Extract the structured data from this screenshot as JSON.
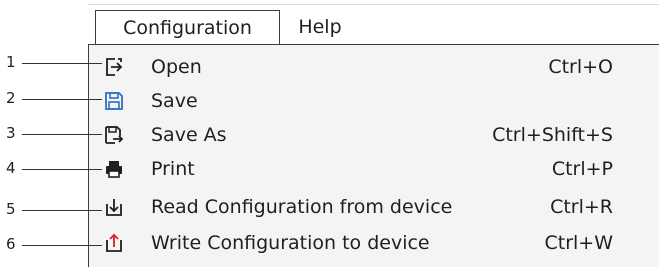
{
  "menubar": {
    "items": [
      {
        "label": "Configuration"
      },
      {
        "label": "Help"
      }
    ]
  },
  "menu": {
    "items": [
      {
        "label": "Open",
        "shortcut": "Ctrl+O",
        "icon": "open-icon"
      },
      {
        "label": "Save",
        "shortcut": "",
        "icon": "save-icon"
      },
      {
        "label": "Save As",
        "shortcut": "Ctrl+Shift+S",
        "icon": "save-as-icon"
      },
      {
        "label": "Print",
        "shortcut": "Ctrl+P",
        "icon": "print-icon"
      },
      {
        "label": "Read Configuration from device",
        "shortcut": "Ctrl+R",
        "icon": "read-config-icon"
      },
      {
        "label": "Write Configuration to device",
        "shortcut": "Ctrl+W",
        "icon": "write-config-icon"
      }
    ]
  },
  "callouts": [
    "1",
    "2",
    "3",
    "4",
    "5",
    "6"
  ],
  "colors": {
    "accent_blue": "#2d6fc6",
    "accent_red": "#d62828",
    "text": "#1f1f1f"
  }
}
